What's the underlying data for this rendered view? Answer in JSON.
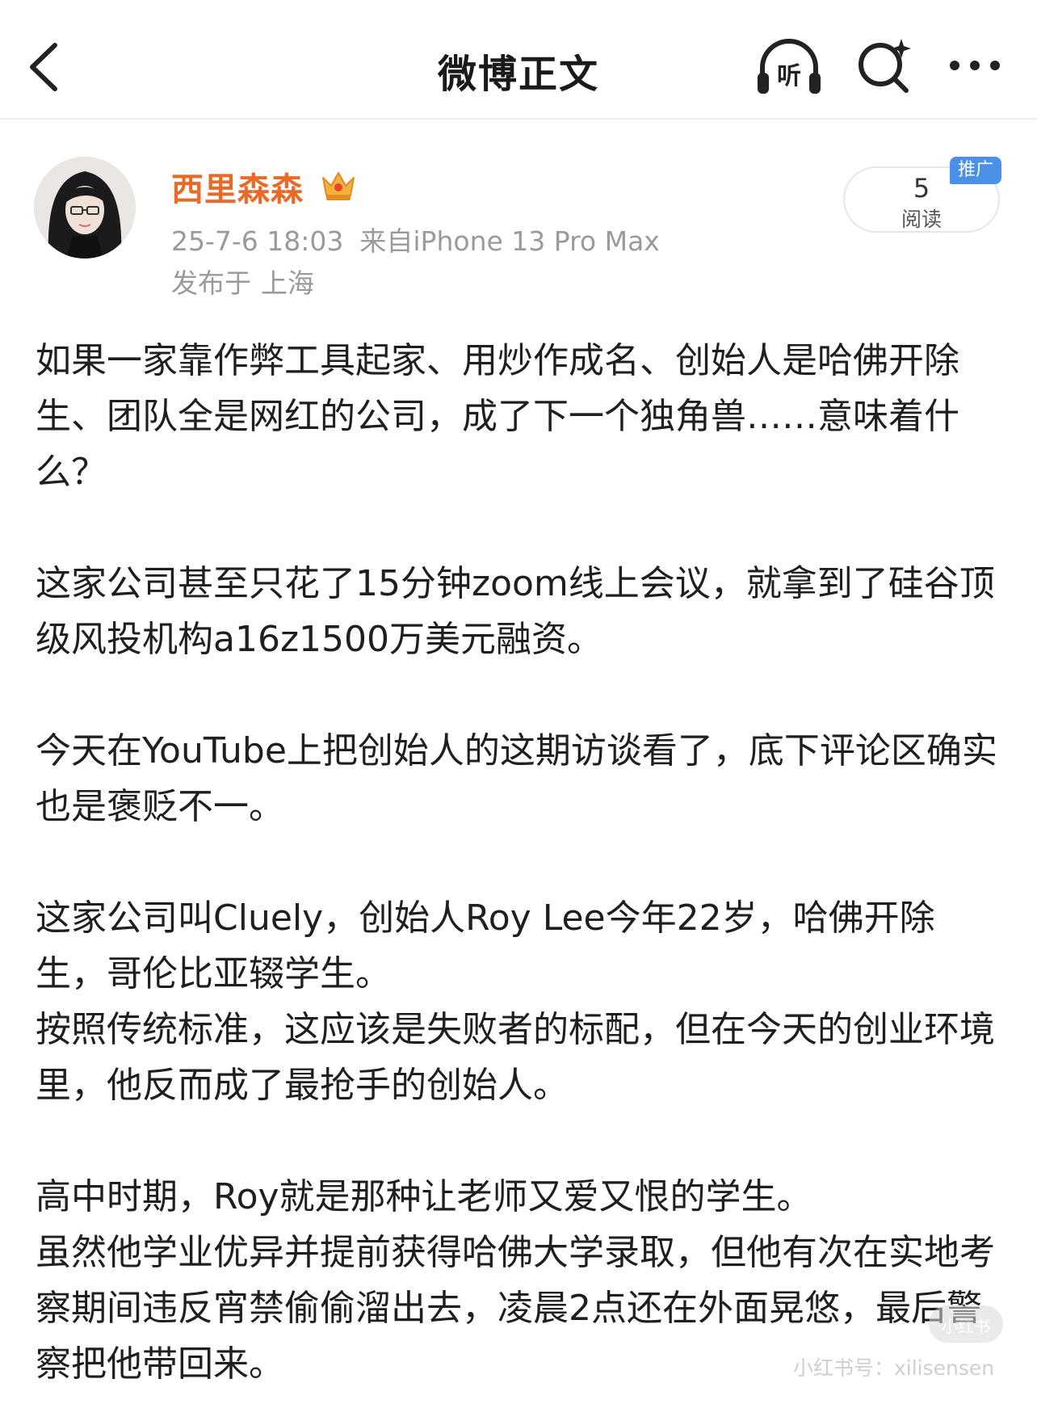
{
  "nav": {
    "title": "微博正文",
    "listen_label": "听",
    "icons": [
      "back-icon",
      "listen-icon",
      "search-icon",
      "more-icon"
    ]
  },
  "author": {
    "name": "西里森森",
    "badge_icon": "crown-icon",
    "date": "25-7-6 18:03",
    "source": "来自iPhone 13 Pro Max",
    "location_prefix": "发布于",
    "location": "上海"
  },
  "reads": {
    "count": "5",
    "label": "阅读",
    "promo_tag": "推广"
  },
  "post": {
    "paragraphs": [
      "如果一家靠作弊工具起家、用炒作成名、创始人是哈佛开除生、团队全是网红的公司，成了下一个独角兽……意味着什么？",
      "这家公司甚至只花了15分钟zoom线上会议，就拿到了硅谷顶级风投机构a16z1500万美元融资。",
      "今天在YouTube上把创始人的这期访谈看了，底下评论区确实也是褒贬不一。",
      "这家公司叫Cluely，创始人Roy Lee今年22岁，哈佛开除生，哥伦比亚辍学生。",
      "按照传统标准，这应该是失败者的标配，但在今天的创业环境里，他反而成了最抢手的创始人。",
      "高中时期，Roy就是那种让老师又爱又恨的学生。",
      "虽然他学业优异并提前获得哈佛大学录取，但他有次在实地考察期间违反宵禁偷偷溜出去，凌晨2点还在外面晃悠，最后警察把他带回来。"
    ]
  },
  "watermark": {
    "text": "小红书号：xilisensen",
    "logo_text": "小红书"
  },
  "colors": {
    "username": "#e86a26",
    "meta": "#9a9a9a",
    "promo_tag": "#4a8fe8",
    "body_text": "#1f1f1f"
  }
}
